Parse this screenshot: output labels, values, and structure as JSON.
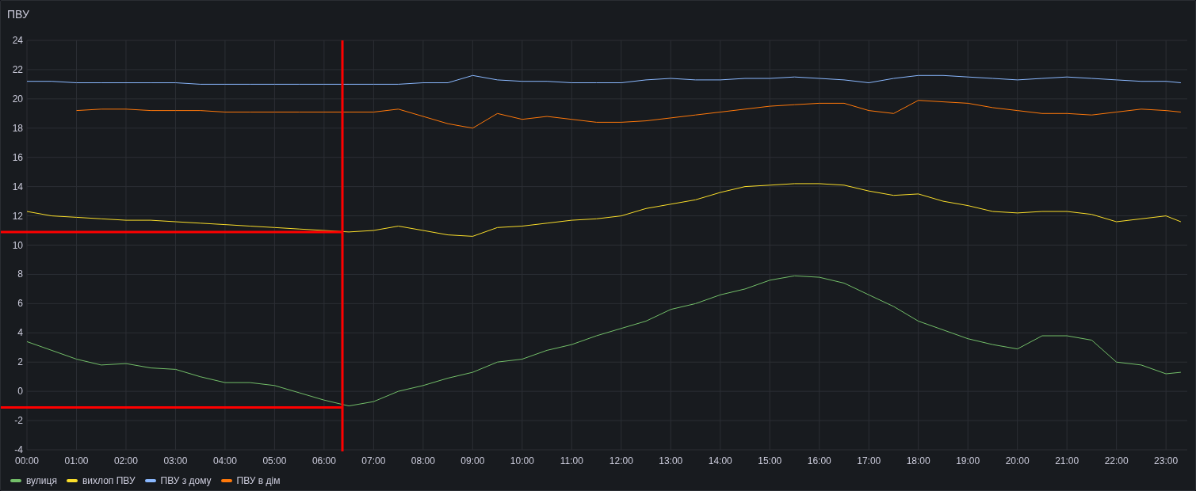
{
  "panel": {
    "title": "ПВУ",
    "chart_data": {
      "type": "line",
      "x": [
        0,
        0.5,
        1,
        1.5,
        2,
        2.5,
        3,
        3.5,
        4,
        4.5,
        5,
        5.5,
        6,
        6.5,
        7,
        7.5,
        8,
        8.5,
        9,
        9.5,
        10,
        10.5,
        11,
        11.5,
        12,
        12.5,
        13,
        13.5,
        14,
        14.5,
        15,
        15.5,
        16,
        16.5,
        17,
        17.5,
        18,
        18.5,
        19,
        19.5,
        20,
        20.5,
        21,
        21.5,
        22,
        22.5,
        23,
        23.3
      ],
      "series": [
        {
          "name": "вулиця",
          "color": "#73bf69",
          "values": [
            3.4,
            2.8,
            2.2,
            1.8,
            1.9,
            1.6,
            1.5,
            1.0,
            0.6,
            0.6,
            0.4,
            -0.1,
            -0.6,
            -1.0,
            -0.7,
            0.0,
            0.4,
            0.9,
            1.3,
            2.0,
            2.2,
            2.8,
            3.2,
            3.8,
            4.3,
            4.8,
            5.6,
            6.0,
            6.6,
            7.0,
            7.6,
            7.9,
            7.8,
            7.4,
            6.6,
            5.8,
            4.8,
            4.2,
            3.6,
            3.2,
            2.9,
            3.8,
            3.8,
            3.5,
            2.0,
            1.8,
            1.2,
            1.3
          ]
        },
        {
          "name": "вихлоп ПВУ",
          "color": "#fade2a",
          "values": [
            12.3,
            12.0,
            11.9,
            11.8,
            11.7,
            11.7,
            11.6,
            11.5,
            11.4,
            11.3,
            11.2,
            11.1,
            11.0,
            10.9,
            11.0,
            11.3,
            11.0,
            10.7,
            10.6,
            11.2,
            11.3,
            11.5,
            11.7,
            11.8,
            12.0,
            12.5,
            12.8,
            13.1,
            13.6,
            14.0,
            14.1,
            14.2,
            14.2,
            14.1,
            13.7,
            13.4,
            13.5,
            13.0,
            12.7,
            12.3,
            12.2,
            12.3,
            12.3,
            12.1,
            11.6,
            11.8,
            12.0,
            11.6
          ]
        },
        {
          "name": "ПВУ з дому",
          "color": "#8ab8ff",
          "values": [
            21.2,
            21.2,
            21.1,
            21.1,
            21.1,
            21.1,
            21.1,
            21.0,
            21.0,
            21.0,
            21.0,
            21.0,
            21.0,
            21.0,
            21.0,
            21.0,
            21.1,
            21.1,
            21.6,
            21.3,
            21.2,
            21.2,
            21.1,
            21.1,
            21.1,
            21.3,
            21.4,
            21.3,
            21.3,
            21.4,
            21.4,
            21.5,
            21.4,
            21.3,
            21.1,
            21.4,
            21.6,
            21.6,
            21.5,
            21.4,
            21.3,
            21.4,
            21.5,
            21.4,
            21.3,
            21.2,
            21.2,
            21.1
          ]
        },
        {
          "name": "ПВУ в дім",
          "color": "#ff780a",
          "values": [
            null,
            null,
            19.2,
            19.3,
            19.3,
            19.2,
            19.2,
            19.2,
            19.1,
            19.1,
            19.1,
            19.1,
            19.1,
            19.1,
            19.1,
            19.3,
            18.8,
            18.3,
            18.0,
            19.0,
            18.6,
            18.8,
            18.6,
            18.4,
            18.4,
            18.5,
            18.7,
            18.9,
            19.1,
            19.3,
            19.5,
            19.6,
            19.7,
            19.7,
            19.2,
            19.0,
            19.9,
            19.8,
            19.7,
            19.4,
            19.2,
            19.0,
            19.0,
            18.9,
            19.1,
            19.3,
            19.2,
            19.1
          ]
        }
      ],
      "xlim": [
        0,
        23.43
      ],
      "ylim": [
        -4,
        24
      ],
      "grid": true,
      "xticks": [
        {
          "value": 0,
          "label": "00:00"
        },
        {
          "value": 1,
          "label": "01:00"
        },
        {
          "value": 2,
          "label": "02:00"
        },
        {
          "value": 3,
          "label": "03:00"
        },
        {
          "value": 4,
          "label": "04:00"
        },
        {
          "value": 5,
          "label": "05:00"
        },
        {
          "value": 6,
          "label": "06:00"
        },
        {
          "value": 7,
          "label": "07:00"
        },
        {
          "value": 8,
          "label": "08:00"
        },
        {
          "value": 9,
          "label": "09:00"
        },
        {
          "value": 10,
          "label": "10:00"
        },
        {
          "value": 11,
          "label": "11:00"
        },
        {
          "value": 12,
          "label": "12:00"
        },
        {
          "value": 13,
          "label": "13:00"
        },
        {
          "value": 14,
          "label": "14:00"
        },
        {
          "value": 15,
          "label": "15:00"
        },
        {
          "value": 16,
          "label": "16:00"
        },
        {
          "value": 17,
          "label": "17:00"
        },
        {
          "value": 18,
          "label": "18:00"
        },
        {
          "value": 19,
          "label": "19:00"
        },
        {
          "value": 20,
          "label": "20:00"
        },
        {
          "value": 21,
          "label": "21:00"
        },
        {
          "value": 22,
          "label": "22:00"
        },
        {
          "value": 23,
          "label": "23:00"
        }
      ],
      "yticks": [
        -4,
        -2,
        0,
        2,
        4,
        6,
        8,
        10,
        12,
        14,
        16,
        18,
        20,
        22,
        24
      ],
      "ref_lines": [
        {
          "axis": "x",
          "value": 6.37,
          "color": "#ff0000"
        },
        {
          "axis": "y",
          "value": 10.9,
          "color": "#ff0000"
        },
        {
          "axis": "y",
          "value": -1.1,
          "color": "#ff0000"
        }
      ]
    }
  }
}
